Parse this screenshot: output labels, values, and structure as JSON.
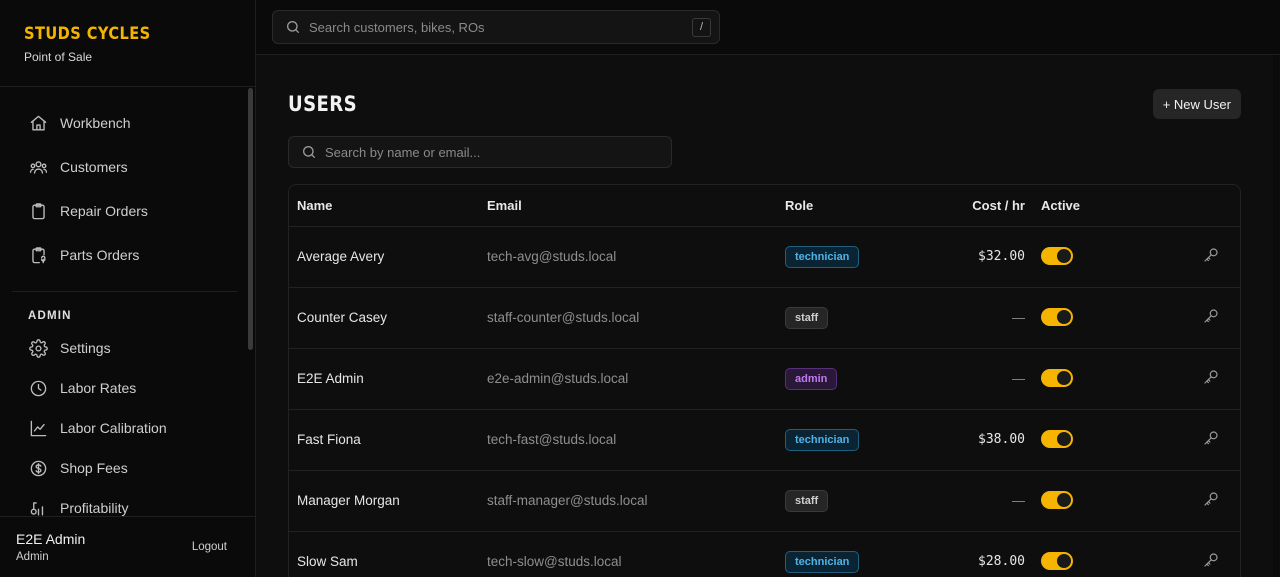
{
  "brand": {
    "title": "STUDS CYCLES",
    "subtitle": "Point of Sale"
  },
  "nav": {
    "items": [
      {
        "label": "Workbench",
        "icon": "home-icon"
      },
      {
        "label": "Customers",
        "icon": "users-icon"
      },
      {
        "label": "Repair Orders",
        "icon": "clipboard-icon"
      },
      {
        "label": "Parts Orders",
        "icon": "clipboard-link-icon"
      }
    ],
    "admin_section": "ADMIN",
    "admin_items": [
      {
        "label": "Settings",
        "icon": "gear-icon"
      },
      {
        "label": "Labor Rates",
        "icon": "clock-icon"
      },
      {
        "label": "Labor Calibration",
        "icon": "line-chart-icon"
      },
      {
        "label": "Shop Fees",
        "icon": "dollar-icon"
      },
      {
        "label": "Profitability",
        "icon": "profit-icon"
      }
    ]
  },
  "user": {
    "name": "E2E Admin",
    "role": "Admin",
    "logout": "Logout"
  },
  "topbar": {
    "search_placeholder": "Search customers, bikes, ROs",
    "shortcut": "/"
  },
  "page": {
    "title": "USERS",
    "new_button": "+ New User",
    "search_placeholder": "Search by name or email..."
  },
  "table": {
    "headers": {
      "name": "Name",
      "email": "Email",
      "role": "Role",
      "cost": "Cost / hr",
      "active": "Active"
    },
    "rows": [
      {
        "name": "Average Avery",
        "email": "tech-avg@studs.local",
        "role": "technician",
        "cost": "$32.00",
        "active": true
      },
      {
        "name": "Counter Casey",
        "email": "staff-counter@studs.local",
        "role": "staff",
        "cost": "—",
        "active": true
      },
      {
        "name": "E2E Admin",
        "email": "e2e-admin@studs.local",
        "role": "admin",
        "cost": "—",
        "active": true
      },
      {
        "name": "Fast Fiona",
        "email": "tech-fast@studs.local",
        "role": "technician",
        "cost": "$38.00",
        "active": true
      },
      {
        "name": "Manager Morgan",
        "email": "staff-manager@studs.local",
        "role": "staff",
        "cost": "—",
        "active": true
      },
      {
        "name": "Slow Sam",
        "email": "tech-slow@studs.local",
        "role": "technician",
        "cost": "$28.00",
        "active": true
      }
    ]
  },
  "colors": {
    "accent": "#f5b400",
    "technician": "#4fb3e8",
    "admin": "#c079f0"
  }
}
